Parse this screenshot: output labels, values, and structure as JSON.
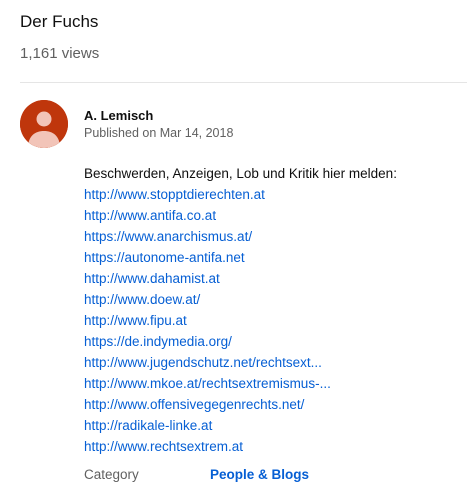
{
  "video": {
    "title": "Der Fuchs",
    "views": "1,161 views"
  },
  "channel": {
    "name": "A. Lemisch",
    "published": "Published on Mar 14, 2018",
    "avatar_icon": "default-avatar-icon",
    "avatar_color": "#bf360c"
  },
  "description": {
    "intro": "Beschwerden, Anzeigen, Lob und Kritik hier melden:",
    "links": [
      "http://www.stopptdierechten.at",
      "http://www.antifa.co.at",
      "https://www.anarchismus.at/",
      "https://autonome-antifa.net",
      "http://www.dahamist.at",
      "http://www.doew.at/",
      "http://www.fipu.at",
      "https://de.indymedia.org/",
      "http://www.jugendschutz.net/rechtsext...",
      "http://www.mkoe.at/rechtsextremismus-...",
      "http://www.offensivegegenrechts.net/",
      "http://radikale-linke.at",
      "http://www.rechtsextrem.at"
    ]
  },
  "metadata": {
    "category_label": "Category",
    "category_value": "People & Blogs"
  },
  "colors": {
    "link": "#065fd4",
    "secondary_text": "#606060",
    "primary_text": "#0f0f0f",
    "divider": "#e5e5e5"
  }
}
